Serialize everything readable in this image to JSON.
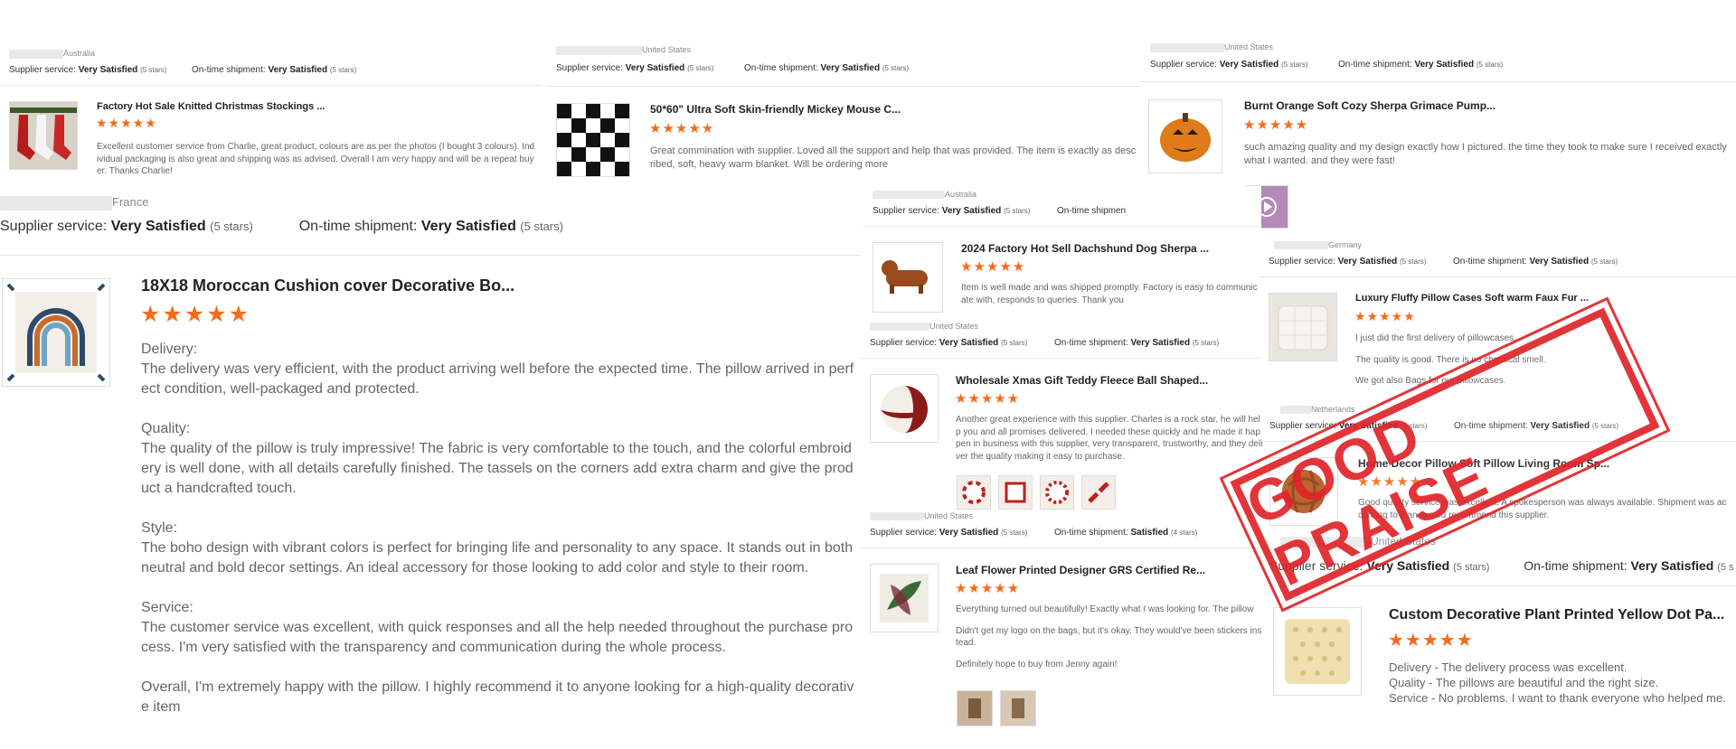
{
  "stamp": {
    "text": "GOOD PRAISE",
    "color": "#e0262b"
  },
  "colors": {
    "star": "#f56b1a"
  },
  "star_glyph": "★★★★★",
  "cards": {
    "c1": {
      "country": "Australia",
      "supplier_label": "Supplier service:",
      "supplier_value": "Very Satisfied",
      "supplier_stars": "(5 stars)",
      "shipment_label": "On-time shipment:",
      "shipment_value": "Very Satisfied",
      "shipment_stars": "(5 stars)",
      "title": "Factory Hot Sale Knitted Christmas Stockings ...",
      "review": "Excellent customer service from Charlie, great product, colours are as per the photos (I bought 3 colours). Individual packaging is also great and shipping was as advised. Overall I am very happy and will be a repeat buyer. Thanks Charlie!"
    },
    "c2": {
      "country": "United States",
      "supplier_label": "Supplier service:",
      "supplier_value": "Very Satisfied",
      "supplier_stars": "(5 stars)",
      "shipment_label": "On-time shipment:",
      "shipment_value": "Very Satisfied",
      "shipment_stars": "(5 stars)",
      "title": "50*60\" Ultra Soft Skin-friendly Mickey Mouse C...",
      "review": "Great commination with supplier. Loved all the support and help that was provided. The item is exactly as described, soft, heavy warm blanket. Will be ordering more"
    },
    "c3": {
      "country": "United States",
      "supplier_label": "Supplier service:",
      "supplier_value": "Very Satisfied",
      "supplier_stars": "(5 stars)",
      "shipment_label": "On-time shipment:",
      "shipment_value": "Very Satisfied",
      "shipment_stars": "(5 stars)",
      "title": "Burnt Orange Soft Cozy Sherpa Grimace Pump...",
      "review": "such amazing quality and my design exactly how I pictured. the time they took to make sure I received exactly what I wanted. and they were fast!"
    },
    "c4": {
      "country": "France",
      "supplier_label": "Supplier service:",
      "supplier_value": "Very Satisfied",
      "supplier_stars": "(5 stars)",
      "shipment_label": "On-time shipment:",
      "shipment_value": "Very Satisfied",
      "shipment_stars": "(5 stars)",
      "title": "18X18 Moroccan Cushion cover Decorative Bo...",
      "paragraphs": [
        "Delivery:",
        "The delivery was very efficient, with the product arriving well before the expected time. The pillow arrived in perfect condition, well-packaged and protected.",
        "",
        "Quality:",
        "The quality of the pillow is truly impressive! The fabric is very comfortable to the touch, and the colorful embroidery is well done, with all details carefully finished. The tassels on the corners add extra charm and give the product a handcrafted touch.",
        "",
        "Style:",
        "The boho design with vibrant colors is perfect for bringing life and personality to any space. It stands out in both neutral and bold decor settings. An ideal accessory for those looking to add color and style to their room.",
        "",
        "Service:",
        "The customer service was excellent, with quick responses and all the help needed throughout the purchase process. I'm very satisfied with the transparency and communication during the whole process.",
        "",
        "Overall, I'm extremely happy with the pillow. I highly recommend it to anyone looking for a high-quality decorative item"
      ]
    },
    "c5": {
      "country": "Australia",
      "supplier_label": "Supplier service:",
      "supplier_value": "Very Satisfied",
      "supplier_stars": "(5 stars)",
      "shipment_label": "On-time shipmen",
      "title": "2024 Factory Hot Sell Dachshund Dog Sherpa ...",
      "review": "Item is well made and was shipped promptly. Factory is easy to communicate with, responds to queries. Thank you"
    },
    "c6": {
      "country": "Germany",
      "supplier_label": "Supplier service:",
      "supplier_value": "Very Satisfied",
      "supplier_stars": "(5 stars)",
      "shipment_label": "On-time shipment:",
      "shipment_value": "Very Satisfied",
      "shipment_stars": "(5 stars)",
      "title": "Luxury Fluffy Pillow Cases Soft warm Faux Fur ...",
      "review_lines": [
        "I just did the first delivery of pillowcases.",
        "The quality is good. There is no chemical smell.",
        "We got also Bags for our pillowcases."
      ]
    },
    "c7": {
      "country": "United States",
      "supplier_label": "Supplier service:",
      "supplier_value": "Very Satisfied",
      "supplier_stars": "(5 stars)",
      "shipment_label": "On-time shipment:",
      "shipment_value": "Very Satisfied",
      "shipment_stars": "(5 stars)",
      "title": "Wholesale Xmas Gift Teddy Fleece Ball Shaped...",
      "review": "Another great experience with this supplier. Charles is a rock star, he will help you and all promises delivered. I needed these quickly and he made it happen in business with this supplier, very transparent, trustworthy, and they deliver the quality making it easy to purchase."
    },
    "c8": {
      "country": "Netherlands",
      "supplier_label": "Supplier service:",
      "supplier_value": "Very Satisfied",
      "supplier_stars": "(5 stars)",
      "shipment_label": "On-time shipment:",
      "shipment_value": "Very Satisfied",
      "shipment_stars": "(5 stars)",
      "title": "Home Decor Pillow Soft Pillow Living Room Sp...",
      "review": "Good quality service was excellent. A spokesperson was always available. Shipment was according to plan. would recommend this supplier."
    },
    "c9": {
      "country": "United States",
      "supplier_label": "Supplier service:",
      "supplier_value": "Very Satisfied",
      "supplier_stars": "(5 stars)",
      "shipment_label": "On-time shipment:",
      "shipment_value": "Satisfied",
      "shipment_stars": "(4 stars)",
      "title": "Leaf Flower Printed Designer GRS Certified Re...",
      "review_lines": [
        "Everything turned out beautifully! Exactly what I was looking for. The pillow",
        "Didn't get my logo on the bags, but it's okay. They would've been stickers instead.",
        "Definitely hope to buy from Jenny again!"
      ]
    },
    "c10": {
      "country": "United States",
      "supplier_label": "Supplier service:",
      "supplier_value": "Very Satisfied",
      "supplier_stars": "(5 stars)",
      "shipment_label": "On-time shipment:",
      "shipment_value": "Very Satisfied",
      "shipment_stars": "(5 s",
      "title": "Custom Decorative Plant Printed Yellow Dot Pa...",
      "review_lines": [
        "Delivery - The delivery process was excellent.",
        "Quality - The pillows are beautiful and the right size.",
        "Service - No problems. I want to thank everyone who helped me."
      ]
    }
  }
}
